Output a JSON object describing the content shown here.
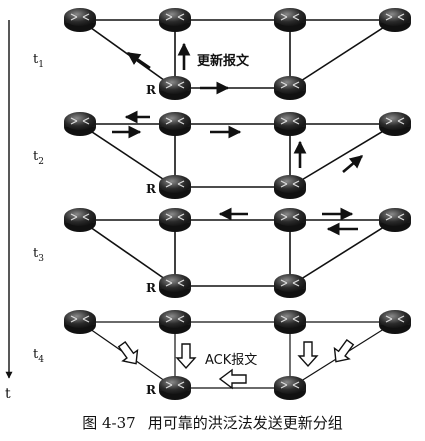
{
  "figure": {
    "time_axis_label": "t",
    "panels": [
      {
        "label": "t1",
        "sub": "1",
        "annotation": "更新报文"
      },
      {
        "label": "t2",
        "sub": "2"
      },
      {
        "label": "t3",
        "sub": "3"
      },
      {
        "label": "t4",
        "sub": "4",
        "annotation": "ACK报文"
      }
    ],
    "source_router_label": "R",
    "caption_number": "图 4-37",
    "caption_text": "用可靠的洪泛法发送更新分组",
    "colors": {
      "ink": "#111111",
      "router": "#2a2a2a",
      "router_highlight": "#9a9a9a"
    }
  }
}
